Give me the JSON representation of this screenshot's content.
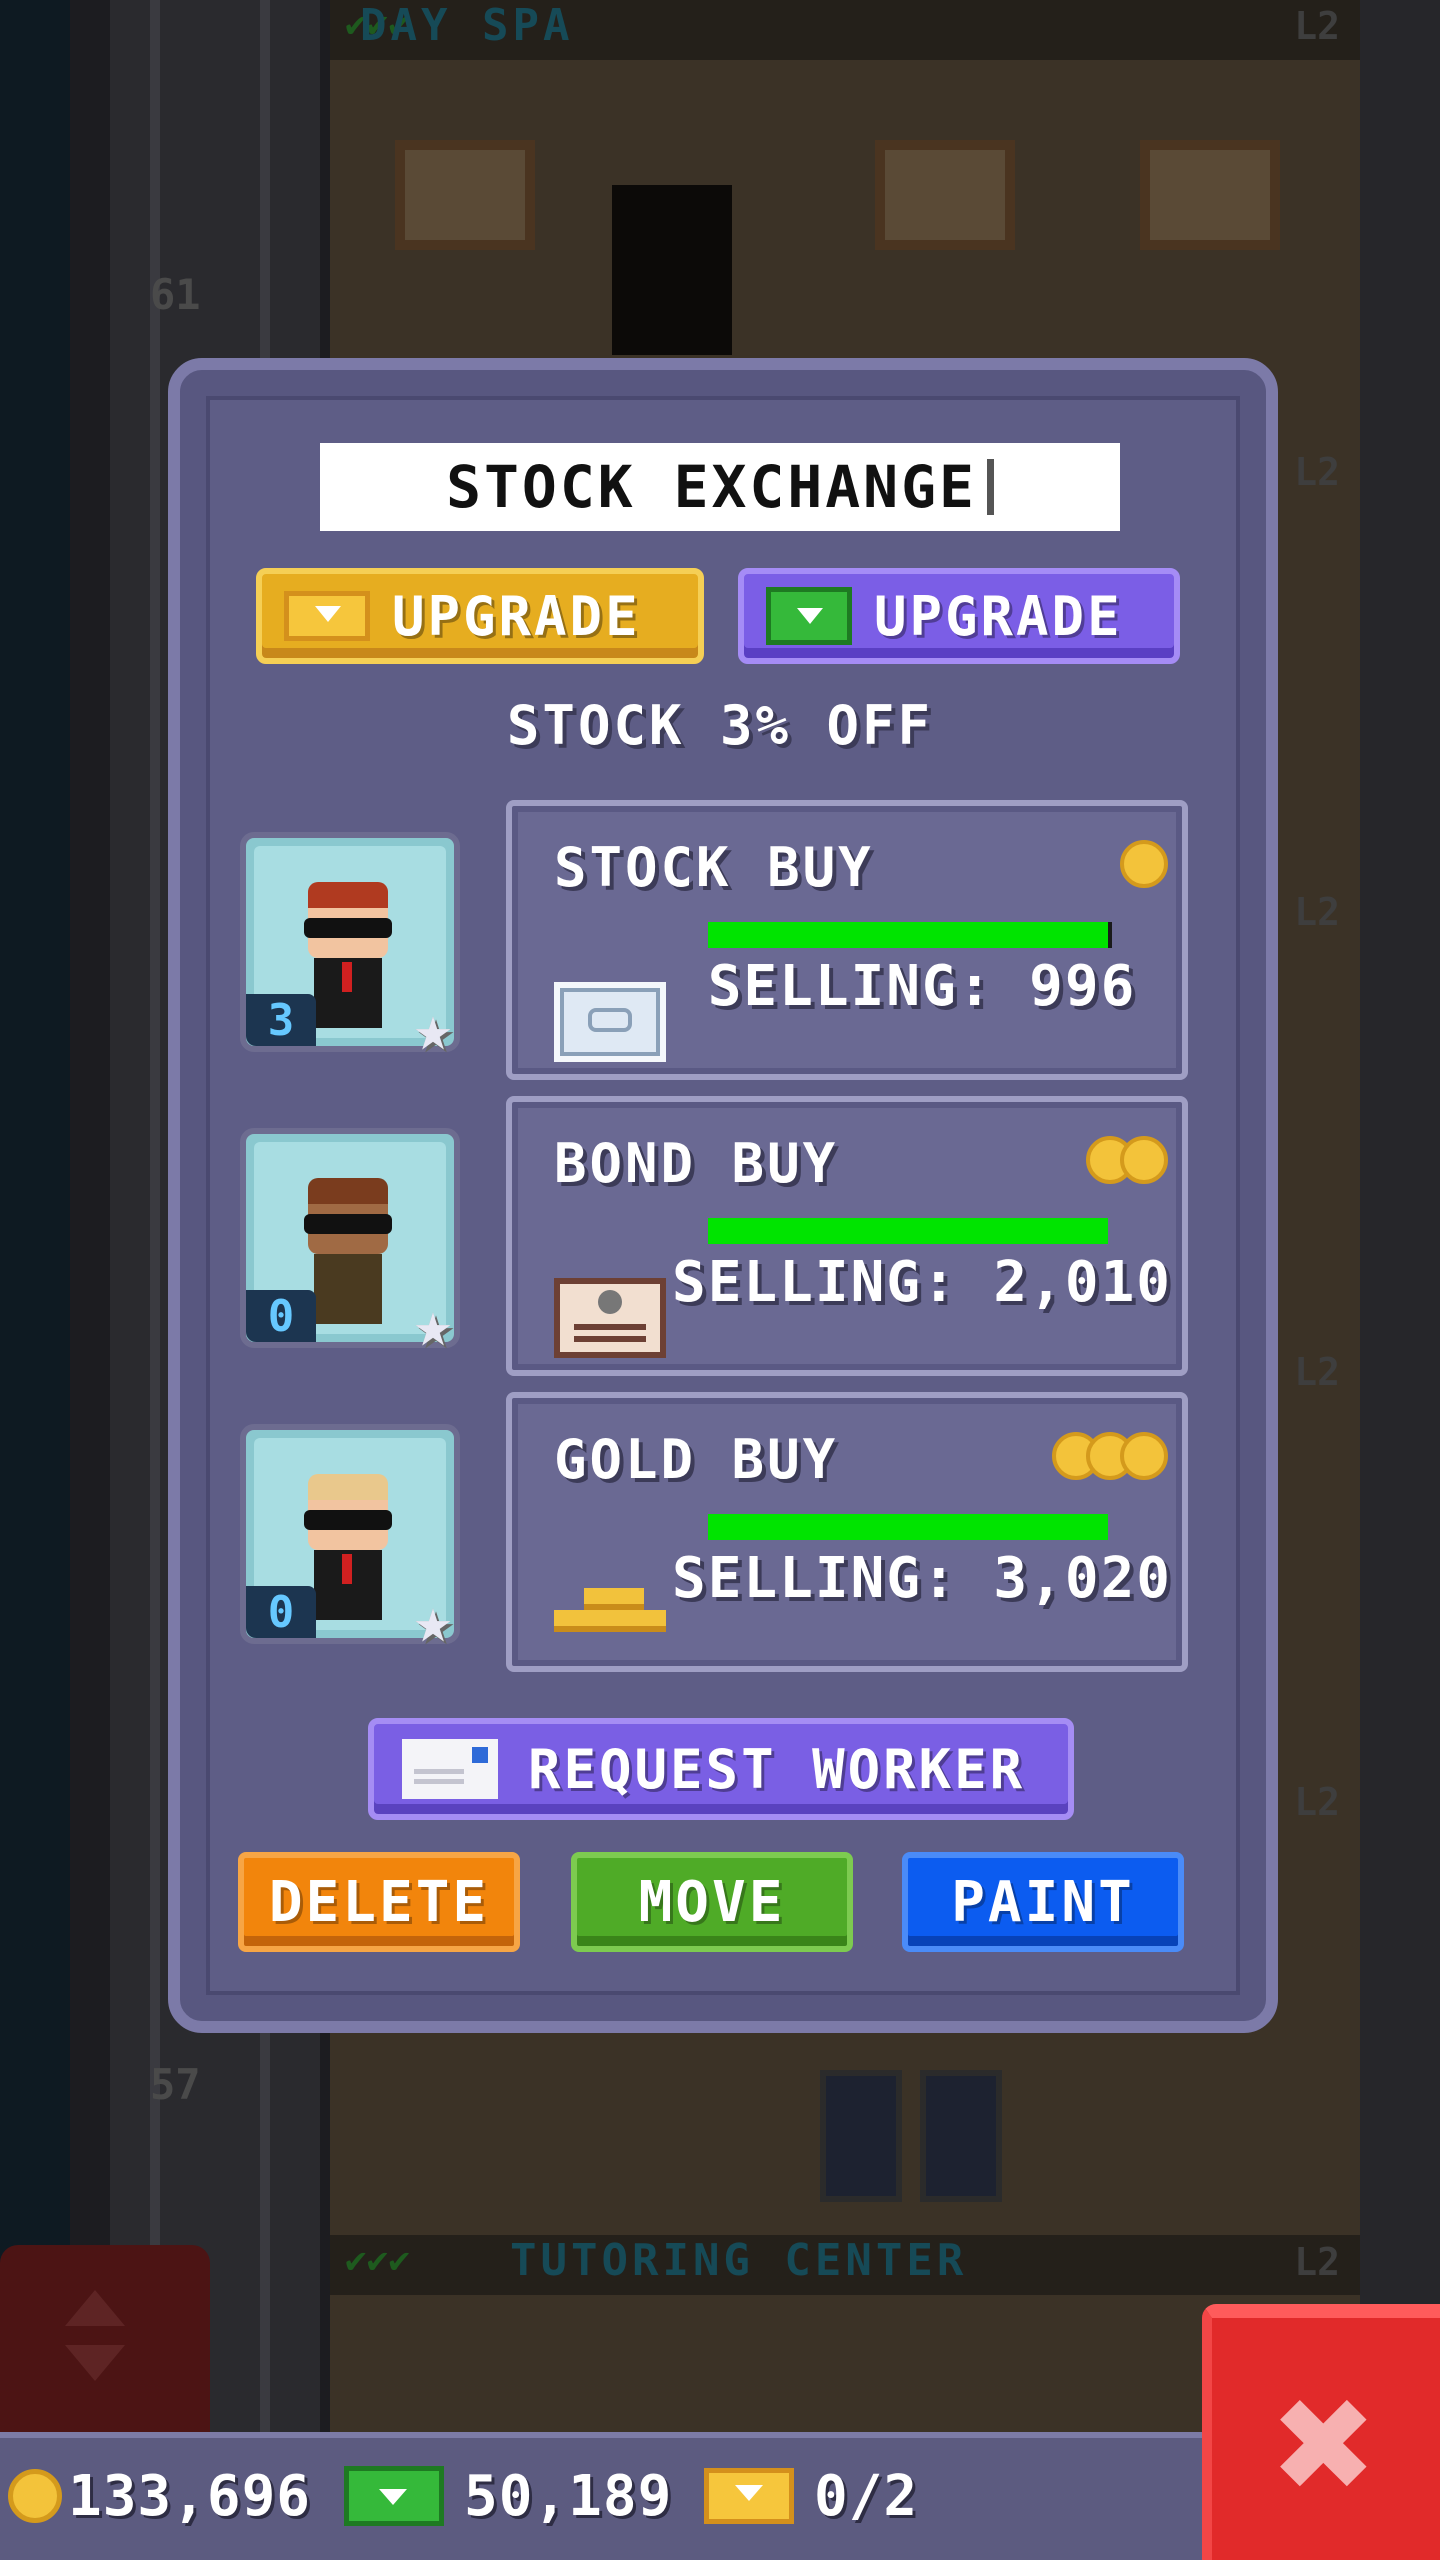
{
  "dialog": {
    "title": "STOCK EXCHANGE",
    "upgrade_bux_label": "UPGRADE",
    "upgrade_cash_label": "UPGRADE",
    "discount_text": "STOCK 3% OFF",
    "request_worker_label": "REQUEST WORKER",
    "delete_label": "DELETE",
    "move_label": "MOVE",
    "paint_label": "PAINT"
  },
  "workers": [
    {
      "level": "3"
    },
    {
      "level": "0"
    },
    {
      "level": "0"
    }
  ],
  "products": [
    {
      "name": "STOCK BUY",
      "selling": "SELLING: 996",
      "coins": 1,
      "stock_fraction": 1.0
    },
    {
      "name": "BOND BUY",
      "selling": "SELLING: 2,010",
      "coins": 2,
      "stock_fraction": 1.0
    },
    {
      "name": "GOLD BUY",
      "selling": "SELLING: 3,020",
      "coins": 3,
      "stock_fraction": 1.0
    }
  ],
  "background": {
    "top_floor_name": "DAY SPA",
    "bottom_floor_name": "TUTORING CENTER",
    "floor_level": "L2",
    "floor_numbers": [
      "61",
      "57"
    ]
  },
  "status_bar": {
    "coins": "133,696",
    "bux": "50,189",
    "vip": "0/2"
  },
  "colors": {
    "panel": "#5e5d86",
    "progress": "#00e400",
    "gold_button": "#e6ad20",
    "purple_button": "#7b5ee6",
    "delete": "#f2850c",
    "move": "#4fab27",
    "paint": "#0c5cf0",
    "close": "#e12a2a"
  },
  "icons": [
    "bux-icon",
    "cash-icon",
    "coin-icon",
    "envelope-icon",
    "star-icon",
    "close-icon",
    "stock-certificate-icon",
    "bond-icon",
    "gold-bars-icon"
  ]
}
